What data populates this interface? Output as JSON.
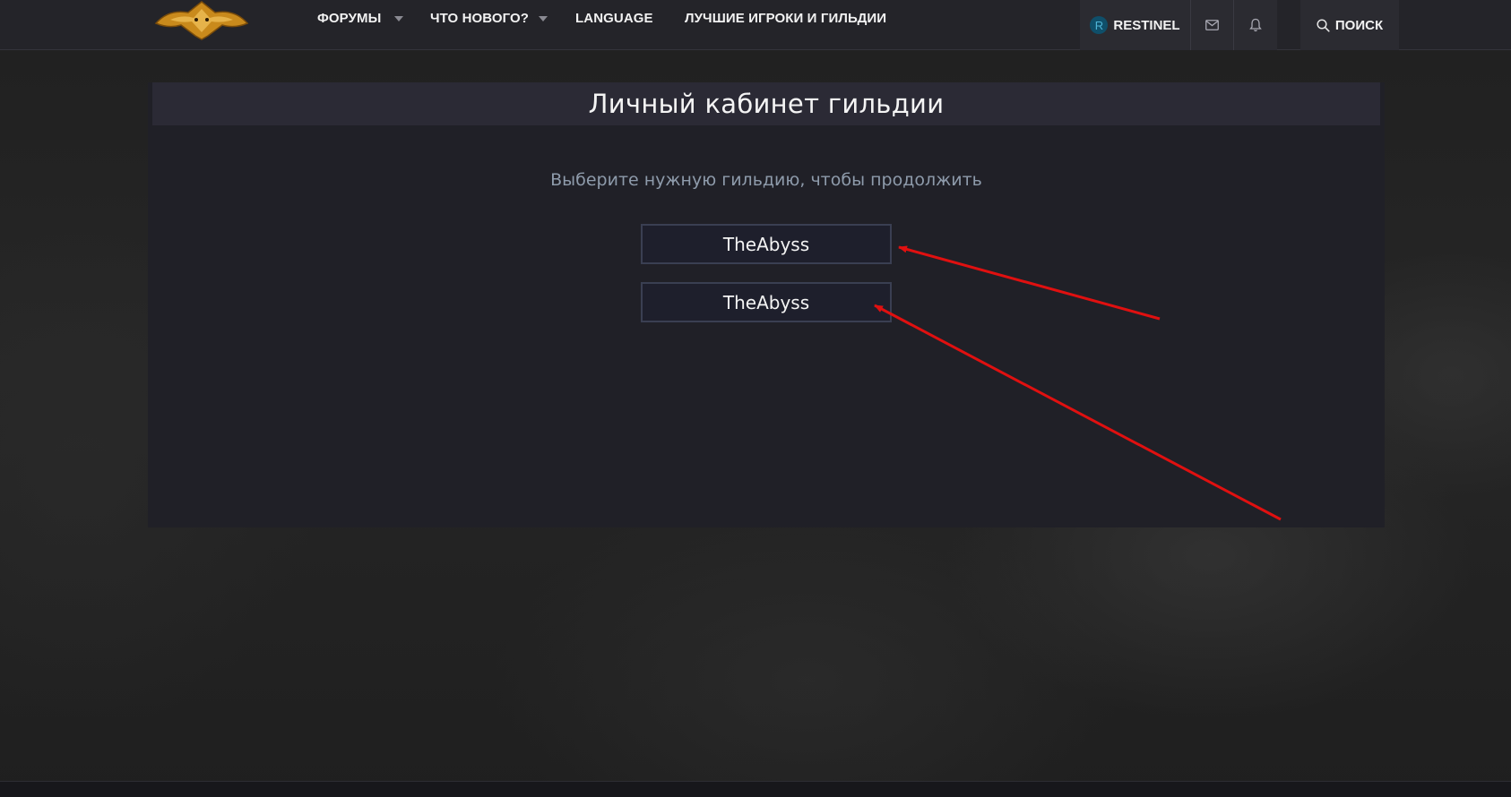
{
  "header": {
    "nav": [
      {
        "label": "ФОРУМЫ",
        "has_dropdown": true
      },
      {
        "label": "ЧТО НОВОГО?",
        "has_dropdown": true
      },
      {
        "label": "LANGUAGE",
        "has_dropdown": false
      },
      {
        "label": "ЛУЧШИЕ ИГРОКИ И ГИЛЬДИИ",
        "has_dropdown": false
      }
    ],
    "user": {
      "avatar_letter": "R",
      "name": "RESTINEL"
    },
    "icons": {
      "messages": "envelope-icon",
      "alerts": "bell-icon",
      "search": "search-icon"
    },
    "search_label": "ПОИСК"
  },
  "panel": {
    "title": "Личный кабинет гильдии",
    "subtitle": "Выберите нужную гильдию, чтобы продолжить",
    "guilds": [
      {
        "label": "TheAbyss"
      },
      {
        "label": "TheAbyss"
      }
    ]
  },
  "colors": {
    "header_bg": "#242429",
    "panel_bg": "#202027",
    "panel_head_bg": "#2b2a35",
    "button_bg": "#1e1f2c",
    "button_border": "#3a3f52",
    "subtitle": "#8e9bab",
    "annotation_arrow": "#e01010",
    "avatar_bg": "#0f4f6a"
  }
}
